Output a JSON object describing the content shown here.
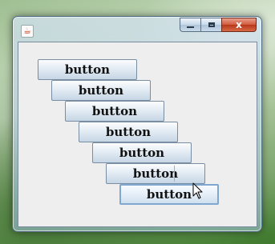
{
  "window": {
    "title": "",
    "icon": "java-icon",
    "controls": [
      "minimize-button",
      "maximize-button",
      "close-button"
    ],
    "close_label": "x"
  },
  "buttons": [
    {
      "label": "button"
    },
    {
      "label": "button"
    },
    {
      "label": "button"
    },
    {
      "label": "button"
    },
    {
      "label": "button"
    },
    {
      "label": "button"
    },
    {
      "label": "button",
      "focused": true
    }
  ],
  "cursor": "arrow-cursor"
}
